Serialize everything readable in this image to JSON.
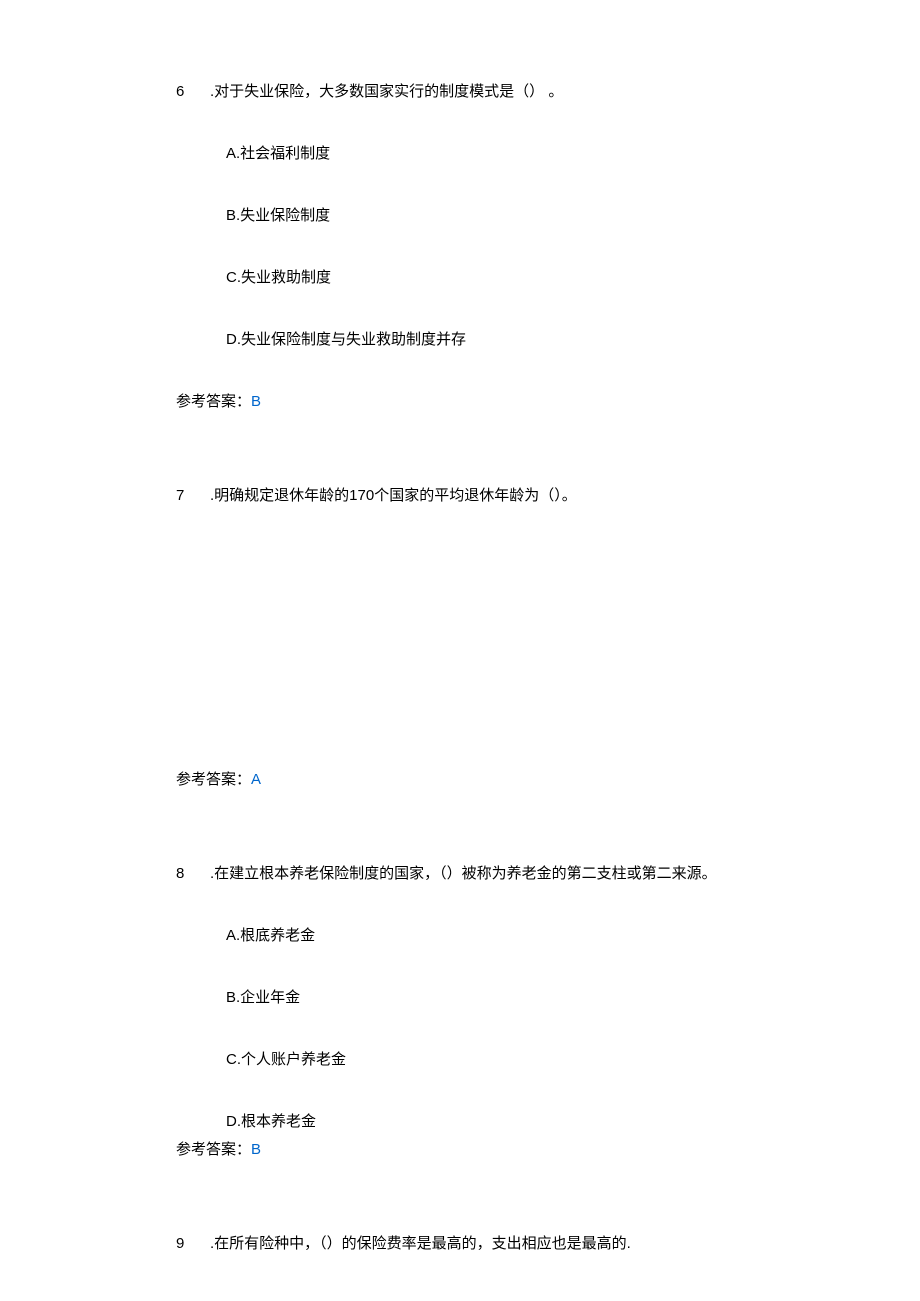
{
  "questions": [
    {
      "num": "6",
      "text": ".对于失业保险，大多数国家实行的制度模式是（） 。",
      "options": {
        "a": "A.社会福利制度",
        "b": "B.失业保险制度",
        "c": "C.失业救助制度",
        "d": "D.失业保险制度与失业救助制度并存"
      },
      "answer_label": "参考答案：",
      "answer_value": "B"
    },
    {
      "num": "7",
      "text_prefix": ".明确规定退休年龄的",
      "text_number": "170",
      "text_suffix": "个国家的平均退休年龄为（）。",
      "answer_label": "参考答案：",
      "answer_value": "A"
    },
    {
      "num": "8",
      "text": ".在建立根本养老保险制度的国家，（）被称为养老金的第二支柱或第二来源。",
      "options": {
        "a": "A.根底养老金",
        "b": "B.企业年金",
        "c": "C.个人账户养老金",
        "d": "D.根本养老金"
      },
      "answer_label": "参考答案：",
      "answer_value": "B"
    },
    {
      "num": "9",
      "text": ".在所有险种中，（）的保险费率是最高的，支出相应也是最高的."
    }
  ]
}
